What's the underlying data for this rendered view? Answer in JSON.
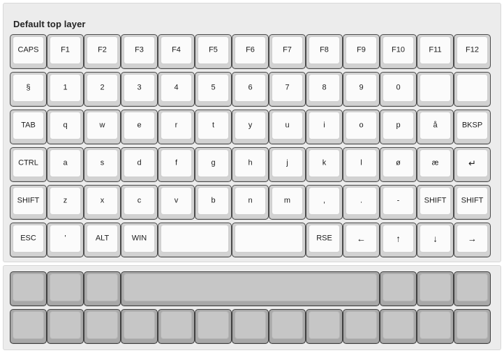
{
  "panels": [
    {
      "id": "default-top-layer",
      "title": "Default top layer",
      "active": true,
      "rows": [
        {
          "keys": [
            {
              "label": "CAPS",
              "w": 1
            },
            {
              "label": "F1",
              "w": 1
            },
            {
              "label": "F2",
              "w": 1
            },
            {
              "label": "F3",
              "w": 1
            },
            {
              "label": "F4",
              "w": 1
            },
            {
              "label": "F5",
              "w": 1
            },
            {
              "label": "F6",
              "w": 1
            },
            {
              "label": "F7",
              "w": 1
            },
            {
              "label": "F8",
              "w": 1
            },
            {
              "label": "F9",
              "w": 1
            },
            {
              "label": "F10",
              "w": 1
            },
            {
              "label": "F11",
              "w": 1
            },
            {
              "label": "F12",
              "w": 1
            }
          ]
        },
        {
          "keys": [
            {
              "label": "§",
              "w": 1
            },
            {
              "label": "1",
              "w": 1
            },
            {
              "label": "2",
              "w": 1
            },
            {
              "label": "3",
              "w": 1
            },
            {
              "label": "4",
              "w": 1
            },
            {
              "label": "5",
              "w": 1
            },
            {
              "label": "6",
              "w": 1
            },
            {
              "label": "7",
              "w": 1
            },
            {
              "label": "8",
              "w": 1
            },
            {
              "label": "9",
              "w": 1
            },
            {
              "label": "0",
              "w": 1
            },
            {
              "label": "",
              "w": 1
            },
            {
              "label": "",
              "w": 1
            }
          ]
        },
        {
          "keys": [
            {
              "label": "TAB",
              "w": 1
            },
            {
              "label": "q",
              "w": 1
            },
            {
              "label": "w",
              "w": 1
            },
            {
              "label": "e",
              "w": 1
            },
            {
              "label": "r",
              "w": 1
            },
            {
              "label": "t",
              "w": 1
            },
            {
              "label": "y",
              "w": 1
            },
            {
              "label": "u",
              "w": 1
            },
            {
              "label": "i",
              "w": 1
            },
            {
              "label": "o",
              "w": 1
            },
            {
              "label": "p",
              "w": 1
            },
            {
              "label": "å",
              "w": 1
            },
            {
              "label": "BKSP",
              "w": 1
            }
          ]
        },
        {
          "keys": [
            {
              "label": "CTRL",
              "w": 1
            },
            {
              "label": "a",
              "w": 1
            },
            {
              "label": "s",
              "w": 1
            },
            {
              "label": "d",
              "w": 1
            },
            {
              "label": "f",
              "w": 1
            },
            {
              "label": "g",
              "w": 1
            },
            {
              "label": "h",
              "w": 1
            },
            {
              "label": "j",
              "w": 1
            },
            {
              "label": "k",
              "w": 1
            },
            {
              "label": "l",
              "w": 1
            },
            {
              "label": "ø",
              "w": 1
            },
            {
              "label": "æ",
              "w": 1
            },
            {
              "label": "↵",
              "w": 1
            }
          ]
        },
        {
          "keys": [
            {
              "label": "SHIFT",
              "w": 1
            },
            {
              "label": "z",
              "w": 1
            },
            {
              "label": "x",
              "w": 1
            },
            {
              "label": "c",
              "w": 1
            },
            {
              "label": "v",
              "w": 1
            },
            {
              "label": "b",
              "w": 1
            },
            {
              "label": "n",
              "w": 1
            },
            {
              "label": "m",
              "w": 1
            },
            {
              "label": ",",
              "w": 1
            },
            {
              "label": ".",
              "w": 1
            },
            {
              "label": "-",
              "w": 1
            },
            {
              "label": "SHIFT",
              "w": 1
            },
            {
              "label": "SHIFT",
              "w": 1
            }
          ]
        },
        {
          "keys": [
            {
              "label": "ESC",
              "w": 1
            },
            {
              "label": "'",
              "w": 1
            },
            {
              "label": "ALT",
              "w": 1
            },
            {
              "label": "WIN",
              "w": 1
            },
            {
              "label": "",
              "w": 2
            },
            {
              "label": "",
              "w": 2
            },
            {
              "label": "RSE",
              "w": 1
            },
            {
              "label": "←",
              "w": 1
            },
            {
              "label": "↑",
              "w": 1
            },
            {
              "label": "↓",
              "w": 1
            },
            {
              "label": "→",
              "w": 1
            }
          ]
        }
      ]
    },
    {
      "id": "inactive-layer",
      "title": "",
      "active": false,
      "rows": [
        {
          "keys": [
            {
              "label": "",
              "w": 1
            },
            {
              "label": "",
              "w": 1
            },
            {
              "label": "",
              "w": 1
            },
            {
              "label": "",
              "w": 7
            },
            {
              "label": "",
              "w": 1
            },
            {
              "label": "",
              "w": 1
            },
            {
              "label": "",
              "w": 1
            }
          ]
        },
        {
          "keys": [
            {
              "label": "",
              "w": 1
            },
            {
              "label": "",
              "w": 1
            },
            {
              "label": "",
              "w": 1
            },
            {
              "label": "",
              "w": 1
            },
            {
              "label": "",
              "w": 1
            },
            {
              "label": "",
              "w": 1
            },
            {
              "label": "",
              "w": 1
            },
            {
              "label": "",
              "w": 1
            },
            {
              "label": "",
              "w": 1
            },
            {
              "label": "",
              "w": 1
            },
            {
              "label": "",
              "w": 1
            },
            {
              "label": "",
              "w": 1
            },
            {
              "label": "",
              "w": 1
            }
          ]
        }
      ]
    }
  ],
  "colors": {
    "panel_background": "#ececec",
    "keycap_active": "#fbfbfb",
    "keycap_inactive": "#c6c6c6",
    "bezel_active": "#d2d2d2",
    "bezel_inactive": "#a8a8a8",
    "text": "#1c1c1c",
    "page_background": "#ffffff"
  }
}
